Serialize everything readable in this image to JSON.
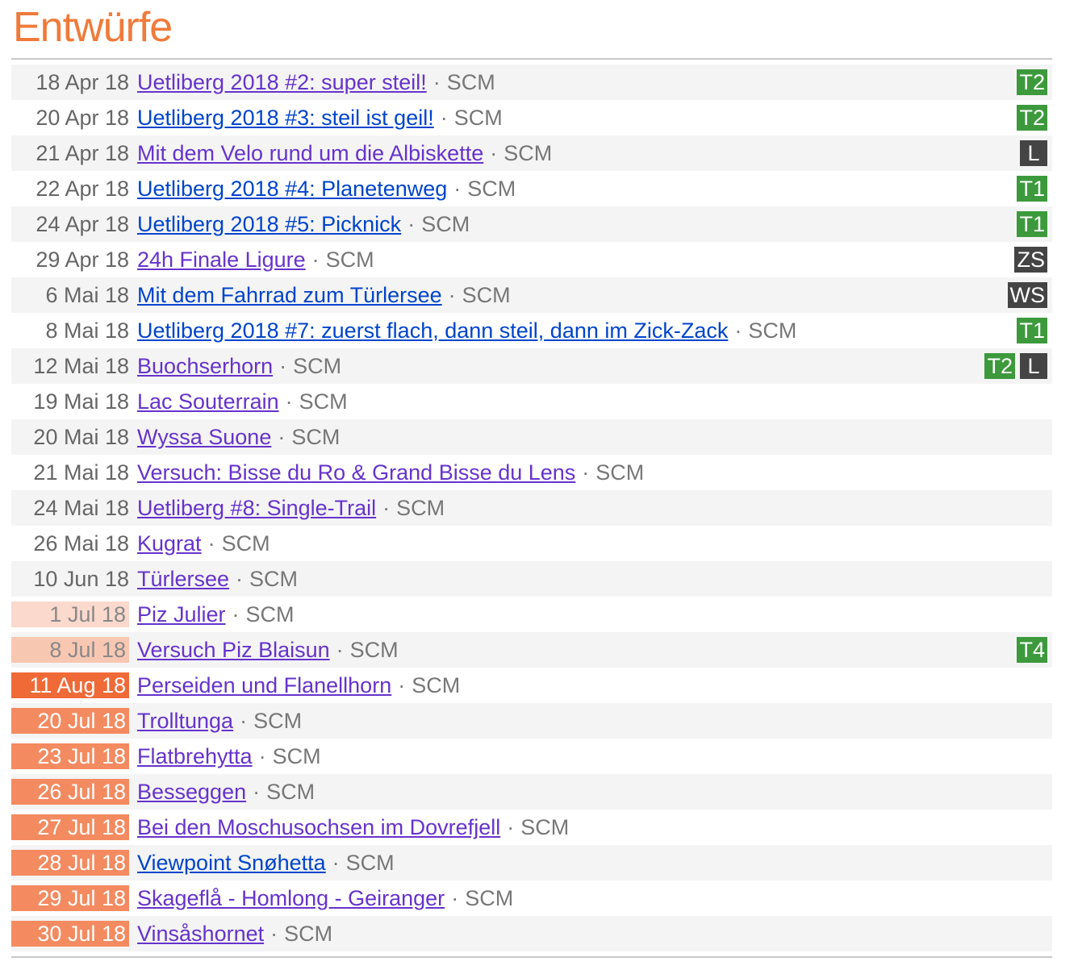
{
  "page": {
    "title": "Entwürfe",
    "accent_color": "#f07a3a"
  },
  "entries": [
    {
      "date": "18 Apr 18",
      "title": "Uetliberg 2018 #2: super steil!",
      "author": "SCM",
      "badges": [
        "T2"
      ],
      "visited": true
    },
    {
      "date": "20 Apr 18",
      "title": "Uetliberg 2018 #3: steil ist geil!",
      "author": "SCM",
      "badges": [
        "T2"
      ],
      "visited": false
    },
    {
      "date": "21 Apr 18",
      "title": "Mit dem Velo rund um die Albiskette",
      "author": "SCM",
      "badges": [
        "L"
      ],
      "visited": true
    },
    {
      "date": "22 Apr 18",
      "title": "Uetliberg 2018 #4: Planetenweg",
      "author": "SCM",
      "badges": [
        "T1"
      ],
      "visited": false
    },
    {
      "date": "24 Apr 18",
      "title": "Uetliberg 2018 #5: Picknick",
      "author": "SCM",
      "badges": [
        "T1"
      ],
      "visited": false
    },
    {
      "date": "29 Apr 18",
      "title": "24h Finale Ligure",
      "author": "SCM",
      "badges": [
        "ZS"
      ],
      "visited": true
    },
    {
      "date": "6 Mai 18",
      "title": "Mit dem Fahrrad zum Türlersee",
      "author": "SCM",
      "badges": [
        "WS"
      ],
      "visited": false
    },
    {
      "date": "8 Mai 18",
      "title": "Uetliberg 2018 #7: zuerst flach, dann steil, dann im Zick-Zack",
      "author": "SCM",
      "badges": [
        "T1"
      ],
      "visited": false
    },
    {
      "date": "12 Mai 18",
      "title": "Buochserhorn",
      "author": "SCM",
      "badges": [
        "T2",
        "L"
      ],
      "visited": true
    },
    {
      "date": "19 Mai 18",
      "title": "Lac Souterrain",
      "author": "SCM",
      "badges": [],
      "visited": true
    },
    {
      "date": "20 Mai 18",
      "title": "Wyssa Suone",
      "author": "SCM",
      "badges": [],
      "visited": true
    },
    {
      "date": "21 Mai 18",
      "title": "Versuch: Bisse du Ro & Grand Bisse du Lens",
      "author": "SCM",
      "badges": [],
      "visited": true
    },
    {
      "date": "24 Mai 18",
      "title": "Uetliberg #8: Single-Trail",
      "author": "SCM",
      "badges": [],
      "visited": true
    },
    {
      "date": "26 Mai 18",
      "title": "Kugrat",
      "author": "SCM",
      "badges": [],
      "visited": true
    },
    {
      "date": "10 Jun 18",
      "title": "Türlersee",
      "author": "SCM",
      "badges": [],
      "visited": true
    },
    {
      "date": "1 Jul 18",
      "title": "Piz Julier",
      "author": "SCM",
      "badges": [],
      "visited": true,
      "highlight": "h1"
    },
    {
      "date": "8 Jul 18",
      "title": "Versuch Piz Blaisun",
      "author": "SCM",
      "badges": [
        "T4"
      ],
      "visited": true,
      "highlight": "h2"
    },
    {
      "date": "11 Aug 18",
      "title": "Perseiden und Flanellhorn",
      "author": "SCM",
      "badges": [],
      "visited": true,
      "highlight": "h4"
    },
    {
      "date": "20 Jul 18",
      "title": "Trolltunga",
      "author": "SCM",
      "badges": [],
      "visited": true,
      "highlight": "h3"
    },
    {
      "date": "23 Jul 18",
      "title": "Flatbrehytta",
      "author": "SCM",
      "badges": [],
      "visited": true,
      "highlight": "h3"
    },
    {
      "date": "26 Jul 18",
      "title": "Besseggen",
      "author": "SCM",
      "badges": [],
      "visited": true,
      "highlight": "h3"
    },
    {
      "date": "27 Jul 18",
      "title": "Bei den Moschusochsen im Dovrefjell",
      "author": "SCM",
      "badges": [],
      "visited": true,
      "highlight": "h3"
    },
    {
      "date": "28 Jul 18",
      "title": "Viewpoint Snøhetta",
      "author": "SCM",
      "badges": [],
      "visited": false,
      "highlight": "h3"
    },
    {
      "date": "29 Jul 18",
      "title": "Skageflå - Homlong - Geiranger",
      "author": "SCM",
      "badges": [],
      "visited": true,
      "highlight": "h3"
    },
    {
      "date": "30 Jul 18",
      "title": "Vinsåshornet",
      "author": "SCM",
      "badges": [],
      "visited": true,
      "highlight": "h3"
    }
  ],
  "badge_colors": {
    "T1": "green",
    "T2": "green",
    "T4": "green",
    "L": "dark",
    "ZS": "dark",
    "WS": "dark"
  },
  "separator": "·"
}
